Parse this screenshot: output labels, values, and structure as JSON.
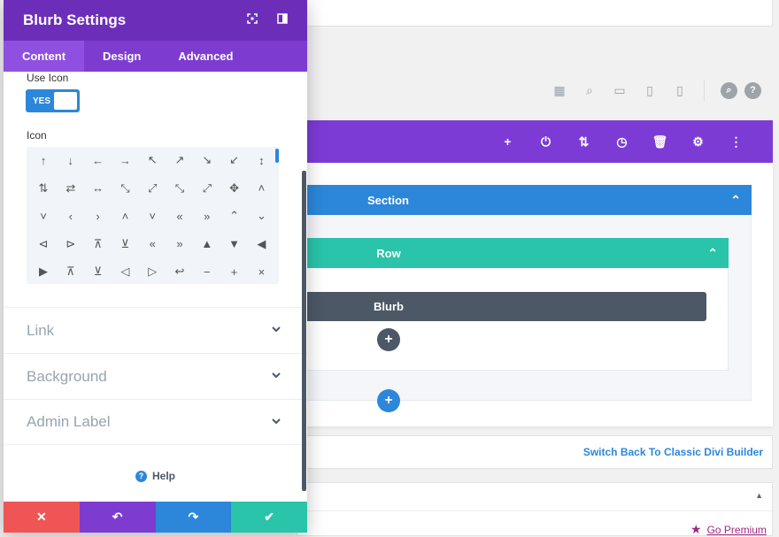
{
  "modal": {
    "title": "Blurb Settings",
    "header_icons": [
      "fullscreen-icon",
      "sidebar-dock-icon"
    ],
    "tabs": [
      {
        "label": "Content",
        "active": true
      },
      {
        "label": "Design",
        "active": false
      },
      {
        "label": "Advanced",
        "active": false
      }
    ],
    "use_icon_label": "Use Icon",
    "toggle_value": "YES",
    "icon_label": "Icon",
    "icon_rows": [
      [
        "↑",
        "↓",
        "←",
        "→",
        "↖",
        "↗",
        "↘",
        "↙",
        "↕"
      ],
      [
        "⇅",
        "⇄",
        "↔",
        "⤡",
        "⤢",
        "⤡",
        "⤢",
        "✥",
        "˄"
      ],
      [
        "˅",
        "‹",
        "›",
        "˄",
        "˅",
        "«",
        "»",
        "⌃",
        "⌄"
      ],
      [
        "⊲",
        "⊳",
        "⊼",
        "⊻",
        "«",
        "»",
        "▲",
        "▼",
        "◀"
      ],
      [
        "▶",
        "⊼",
        "⊻",
        "◁",
        "▷",
        "↩",
        "−",
        "+",
        "×"
      ]
    ],
    "accordions": [
      {
        "label": "Link"
      },
      {
        "label": "Background"
      },
      {
        "label": "Admin Label"
      }
    ],
    "help_label": "Help",
    "footer_buttons": [
      {
        "icon": "✕",
        "color": "#ef5555",
        "name": "discard-button"
      },
      {
        "icon": "↶",
        "color": "#7e3bd0",
        "name": "undo-button"
      },
      {
        "icon": "↷",
        "color": "#2c87da",
        "name": "redo-button"
      },
      {
        "icon": "✔",
        "color": "#29c4a9",
        "name": "save-button"
      }
    ]
  },
  "page": {
    "builder_bar_icons": [
      "+",
      "⏻",
      "⇅",
      "◷",
      "🗑",
      "⚙",
      "⋮"
    ],
    "section_label": "Section",
    "row_label": "Row",
    "module_label": "Blurb",
    "switch_link": "Switch Back To Classic Divi Builder",
    "premium_link": "Go Premium",
    "view_icons": [
      "wireframe-icon",
      "zoom-icon",
      "desktop-icon",
      "tablet-icon",
      "phone-icon"
    ],
    "colors": {
      "purple": "#6c2eb9",
      "blue": "#2c87da",
      "teal": "#29c4a9",
      "dark": "#4c5866",
      "red": "#ef5555"
    }
  }
}
